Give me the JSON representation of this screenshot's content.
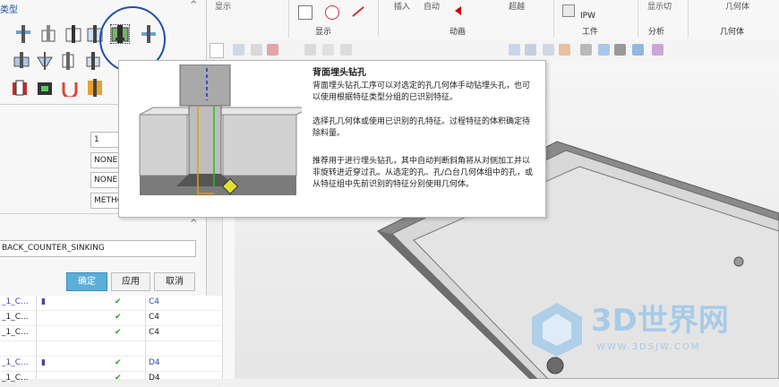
{
  "dialog": {
    "type_header": "类型",
    "fields": [
      "1",
      "NONE",
      "NONE",
      "METHOD"
    ],
    "operation_name": "BACK_COUNTER_SINKING",
    "ok_label": "确定",
    "apply_label": "应用",
    "cancel_label": "取消"
  },
  "ribbon": {
    "top_labels": [
      "显示",
      "插入",
      "自动",
      "超越",
      "显示切",
      "IPW",
      "分析",
      "几何体"
    ],
    "groups": [
      "显示",
      "动画",
      "工件",
      "分析",
      "几何体"
    ],
    "ipw_label": "IPW"
  },
  "list": {
    "rows": [
      {
        "name": "_1_C...",
        "status": "✔",
        "tool": "C4"
      },
      {
        "name": "_1_C...",
        "status": "✔",
        "tool": "C4"
      },
      {
        "name": "_1_C...",
        "status": "✔",
        "tool": "C4"
      },
      {
        "name": "",
        "status": "",
        "tool": ""
      },
      {
        "name": "_1_C...",
        "status": "✔",
        "tool": "D4"
      },
      {
        "name": "_1_C...",
        "status": "✔",
        "tool": "D4"
      }
    ]
  },
  "tooltip": {
    "title": "背面埋头钻孔",
    "para1": "背面埋头钻孔工序可以对选定的孔几何体手动钻埋头孔，也可以使用根据特征类型分组的已识别特征。",
    "para2": "选择孔几何体或使用已识别的孔特征。过程特征的体积确定待除料量。",
    "para3": "推荐用于进行埋头钻孔，其中自动判断斜角将从对侧加工并以非旋转进近穿过孔。从选定的孔、孔/凸台几何体组中的孔，或从特征组中先前识别的特征分别使用几何体。"
  },
  "watermark": {
    "brand": "3D世界网",
    "url": "WWW.3DSJW.COM"
  },
  "colors": {
    "accent_blue": "#1f4fa8",
    "ok_button": "#5aaed8",
    "check_green": "#2a9d2a"
  }
}
